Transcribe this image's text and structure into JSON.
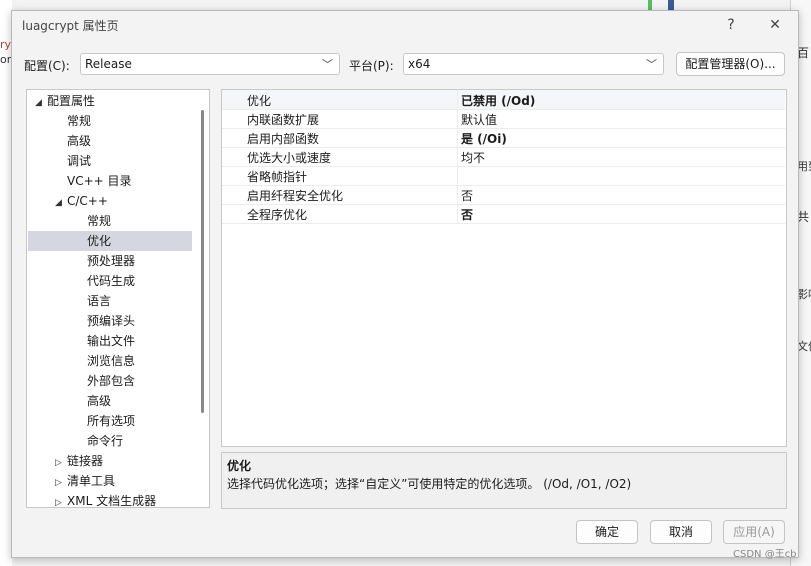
{
  "window": {
    "title": "luagcrypt 属性页",
    "help_glyph": "?",
    "close_glyph": "✕"
  },
  "config": {
    "label": "配置(C):",
    "value": "Release",
    "platform_label": "平台(P):",
    "platform_value": "x64",
    "manager_button": "配置管理器(O)..."
  },
  "tree": {
    "items": [
      {
        "label": "配置属性",
        "level": 0,
        "exp": "◢"
      },
      {
        "label": "常规",
        "level": 1,
        "exp": ""
      },
      {
        "label": "高级",
        "level": 1,
        "exp": ""
      },
      {
        "label": "调试",
        "level": 1,
        "exp": ""
      },
      {
        "label": "VC++ 目录",
        "level": 1,
        "exp": ""
      },
      {
        "label": "C/C++",
        "level": 1,
        "exp": "◢"
      },
      {
        "label": "常规",
        "level": 2,
        "exp": ""
      },
      {
        "label": "优化",
        "level": 2,
        "exp": "",
        "selected": true
      },
      {
        "label": "预处理器",
        "level": 2,
        "exp": ""
      },
      {
        "label": "代码生成",
        "level": 2,
        "exp": ""
      },
      {
        "label": "语言",
        "level": 2,
        "exp": ""
      },
      {
        "label": "预编译头",
        "level": 2,
        "exp": ""
      },
      {
        "label": "输出文件",
        "level": 2,
        "exp": ""
      },
      {
        "label": "浏览信息",
        "level": 2,
        "exp": ""
      },
      {
        "label": "外部包含",
        "level": 2,
        "exp": ""
      },
      {
        "label": "高级",
        "level": 2,
        "exp": ""
      },
      {
        "label": "所有选项",
        "level": 2,
        "exp": ""
      },
      {
        "label": "命令行",
        "level": 2,
        "exp": ""
      },
      {
        "label": "链接器",
        "level": 1,
        "exp": "▷"
      },
      {
        "label": "清单工具",
        "level": 1,
        "exp": "▷"
      },
      {
        "label": "XML 文档生成器",
        "level": 1,
        "exp": "▷"
      }
    ]
  },
  "properties": [
    {
      "name": "优化",
      "value": "已禁用 (/Od)",
      "bold": true
    },
    {
      "name": "内联函数扩展",
      "value": "默认值",
      "bold": false
    },
    {
      "name": "启用内部函数",
      "value": "是 (/Oi)",
      "bold": true
    },
    {
      "name": "优选大小或速度",
      "value": "均不",
      "bold": false
    },
    {
      "name": "省略帧指针",
      "value": "",
      "bold": false
    },
    {
      "name": "启用纤程安全优化",
      "value": "否",
      "bold": false
    },
    {
      "name": "全程序优化",
      "value": "否",
      "bold": true
    }
  ],
  "description": {
    "title": "优化",
    "text": "选择代码优化选项；选择“自定义”可使用特定的优化选项。     (/Od, /O1, /O2)"
  },
  "buttons": {
    "ok": "确定",
    "cancel": "取消",
    "apply": "应用(A)"
  },
  "background": {
    "left_text_1": "ryp",
    "left_text_2": "on",
    "right_text_1": "百",
    "right_text_2": "用到",
    "right_text_3": "共",
    "right_text_4": "影响",
    "right_text_5": "文件"
  },
  "watermark": "CSDN @王cb"
}
